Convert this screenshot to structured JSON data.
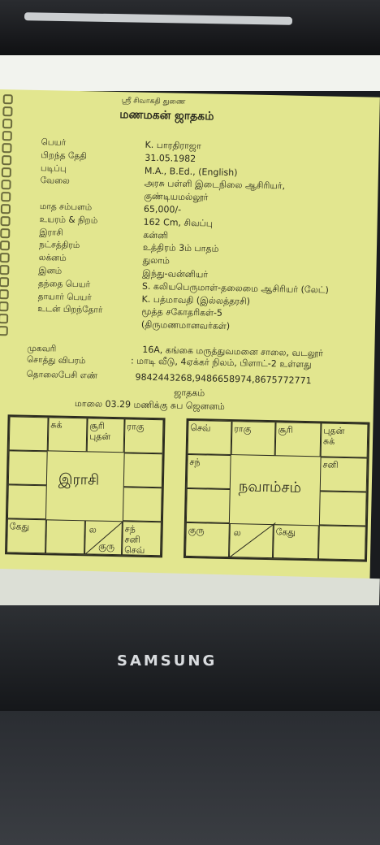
{
  "monitor": {
    "brand": "SAMSUNG"
  },
  "doc": {
    "header_small": "ஸ்ரீ சிவாகதி துணை",
    "title": "மணமகன் ஜாதகம்",
    "fields": [
      {
        "label": "பெயர்",
        "value": "K. பாரதிராஜா"
      },
      {
        "label": "பிறந்த தேதி",
        "value": "31.05.1982"
      },
      {
        "label": "படிப்பு",
        "value": "M.A., B.Ed., (English)"
      },
      {
        "label": "வேலை",
        "value": "அரசு பள்ளி இடைநிலை ஆசிரியர்,"
      },
      {
        "label": "",
        "value": "குண்டியமல்லூர்"
      },
      {
        "label": "மாத சம்பளம்",
        "value": "65,000/-"
      },
      {
        "label": "உயரம் & நிறம்",
        "value": "162 Cm, சிவப்பு"
      },
      {
        "label": "இராசி",
        "value": "கன்னி"
      },
      {
        "label": "நட்சத்திரம்",
        "value": "உத்திரம் 3ம் பாதம்"
      },
      {
        "label": "லக்னம்",
        "value": "துலாம்"
      },
      {
        "label": "இனம்",
        "value": "இந்து-வன்னியர்"
      },
      {
        "label": "தந்தை பெயர்",
        "value": "S. கலியபெருமாள்-தலைமை ஆசிரியர் (லேட்)"
      },
      {
        "label": "தாயார் பெயர்",
        "value": "K. பத்மாவதி (இல்லத்தரசி)"
      },
      {
        "label": "உடன் பிறந்தோர்",
        "value": "மூத்த சகோதரிகள்-5"
      },
      {
        "label": "",
        "value": "(திருமணமானவர்கள்)"
      }
    ],
    "address_label": "முகவரி",
    "address_value": "16A, கங்கை மருத்துவமனை சாலை, வடலூர்",
    "property_label": "சொத்து விபரம்",
    "property_value": ": மாடி வீடு, 4ஏக்கர் நிலம், பிளாட்-2 உள்ளது",
    "phone_label": "தொலைபேசி எண்",
    "phone_value": "9842443268,9486658974,8675772771",
    "jathagam": "ஜாதகம்",
    "birth_time": "மாலை 03.29 மணிக்கு சுப ஜெனனம்",
    "rasi_chart": {
      "title": "இராசி",
      "cells": {
        "r0c1": "சுக்",
        "r0c2": "சூரி\nபுதன்",
        "r0c3": "ராகு",
        "r3c0": "கேது",
        "r3c2a": "ல",
        "r3c2b": "குரு",
        "r3c3": "சந்\nசனி\nசெவ்"
      }
    },
    "navamsa_chart": {
      "title": "நவாம்சம்",
      "cells": {
        "r0c0": "செவ்",
        "r0c1": "ராகு",
        "r0c2": "சூரி",
        "r0c3": "புதன்\nசுக்",
        "r1c0": "சந்",
        "r1c3": "சனி",
        "r3c0": "குரு",
        "r3c1": "ல",
        "r3c2": "கேது"
      }
    }
  }
}
